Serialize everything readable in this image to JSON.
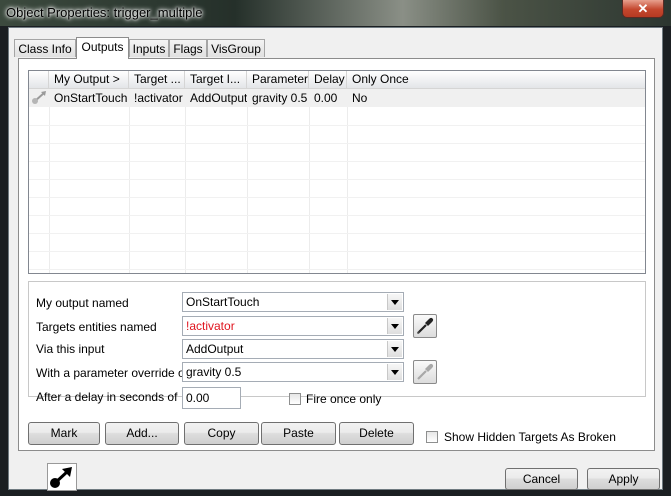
{
  "window": {
    "title": "Object Properties: trigger_multiple",
    "close_glyph": "✕"
  },
  "tabs": [
    {
      "label": "Class Info",
      "active": false
    },
    {
      "label": "Outputs",
      "active": true
    },
    {
      "label": "Inputs",
      "active": false
    },
    {
      "label": "Flags",
      "active": false
    },
    {
      "label": "VisGroup",
      "active": false
    }
  ],
  "outputs_table": {
    "columns": [
      "My Output  >",
      "Target ...",
      "Target I...",
      "Parameter",
      "Delay",
      "Only Once"
    ],
    "rows": [
      {
        "icon": "output-connection-icon",
        "my_output": "OnStartTouch",
        "target": "!activator",
        "target_input": "AddOutput",
        "parameter": "gravity 0.5",
        "delay": "0.00",
        "only_once": "No"
      }
    ]
  },
  "editor": {
    "my_output_label": "My output named",
    "my_output_value": "OnStartTouch",
    "targets_label": "Targets entities named",
    "targets_value": "!activator",
    "targets_value_color": "#e0141e",
    "via_input_label": "Via this input",
    "via_input_value": "AddOutput",
    "parameter_label": "With a parameter override of",
    "parameter_value": "gravity 0.5",
    "delay_label": "After a delay in seconds of",
    "delay_value": "0.00",
    "fire_once_label": "Fire once only",
    "fire_once_checked": false
  },
  "actions": {
    "mark": "Mark",
    "add": "Add...",
    "copy": "Copy",
    "paste": "Paste",
    "delete": "Delete",
    "show_hidden_label": "Show Hidden Targets As Broken",
    "show_hidden_checked": false
  },
  "footer": {
    "cancel": "Cancel",
    "apply": "Apply",
    "entity_icon": "output-arrow-icon"
  }
}
